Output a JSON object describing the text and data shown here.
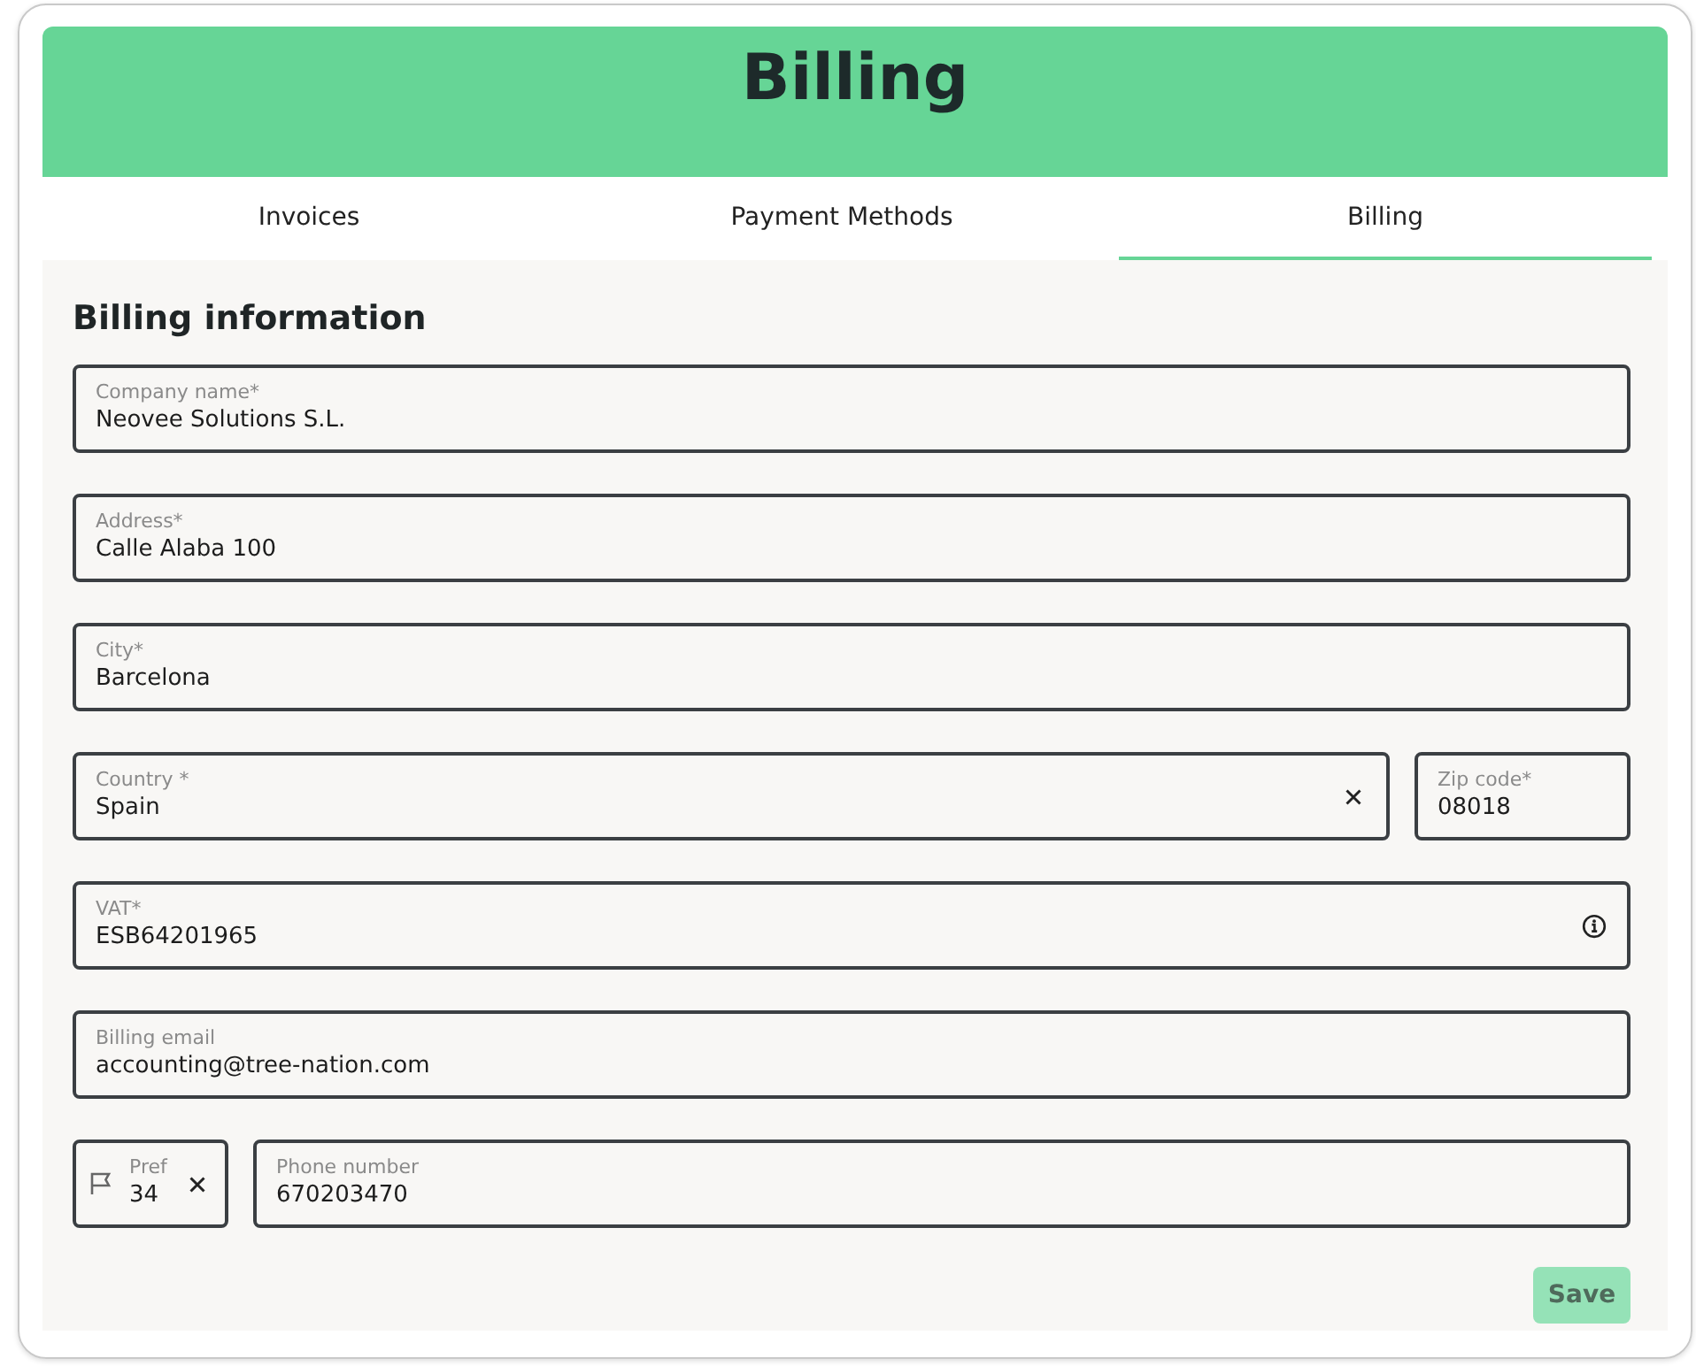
{
  "header": {
    "title": "Billing"
  },
  "tabs": [
    {
      "label": "Invoices",
      "selected": false
    },
    {
      "label": "Payment Methods",
      "selected": false
    },
    {
      "label": "Billing",
      "selected": true
    }
  ],
  "section_title": "Billing information",
  "rows": [
    {
      "fields": [
        {
          "kind": "text",
          "label": "Company name*",
          "value": "Neovee Solutions S.L."
        }
      ]
    },
    {
      "fields": [
        {
          "kind": "text",
          "label": "Address*",
          "value": "Calle Alaba 100"
        }
      ]
    },
    {
      "fields": [
        {
          "kind": "text",
          "label": "City*",
          "value": "Barcelona"
        }
      ]
    },
    {
      "fields": [
        {
          "kind": "select",
          "label": "Country *",
          "value": "Spain"
        },
        {
          "kind": "small",
          "label": "Zip code*",
          "value": "08018"
        }
      ]
    },
    {
      "fields": [
        {
          "kind": "info",
          "label": "VAT*",
          "value": "ESB64201965"
        }
      ]
    },
    {
      "fields": [
        {
          "kind": "text",
          "label": "Billing email",
          "value": "accounting@tree-nation.com"
        }
      ]
    },
    {
      "fields": [
        {
          "kind": "prefix",
          "label": "Pref",
          "value": "34"
        },
        {
          "kind": "text",
          "label": "Phone number",
          "value": "670203470"
        }
      ]
    }
  ],
  "save_button": {
    "label": "Save",
    "disabled": true
  }
}
